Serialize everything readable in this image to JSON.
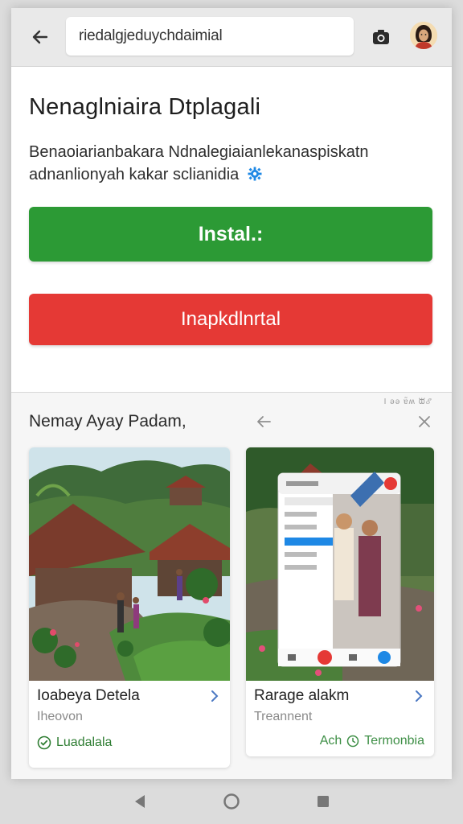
{
  "topbar": {
    "url_text": "riedalgjeduychdaimial",
    "back_icon": "arrow-left-icon",
    "camera_icon": "camera-icon",
    "avatar_icon": "user-avatar"
  },
  "dialog": {
    "title": "Nenaglniaira Dtplagali",
    "description": "Benaoiarianbakara Ndnalegiaianlekanaspiskatn adnanlionyah kakar sclianidia",
    "install_label": "Instal.:",
    "uninstall_label": "Inapkdlnrtal",
    "install_color": "#2c9a35",
    "uninstall_color": "#e53935"
  },
  "section": {
    "status_text": "I ǝǝ        ɐ̃ʍ ᙔℰ",
    "title": "Nemay Ayay Padam,",
    "back_icon": "arrow-left-icon",
    "close_icon": "close-icon"
  },
  "cards": [
    {
      "name": "Ioabeya Detela",
      "subtitle": "Iheovon",
      "status": "Luadalala",
      "status_icon": "check-circle-icon"
    },
    {
      "name": "Rarage alakm",
      "subtitle": "Treannent",
      "footer_left": "Ach",
      "footer_right": "Termonbia",
      "footer_icon": "clock-icon"
    }
  ],
  "navbar": {
    "back_icon": "nav-back-icon",
    "home_icon": "nav-home-icon",
    "recents_icon": "nav-recents-icon"
  }
}
